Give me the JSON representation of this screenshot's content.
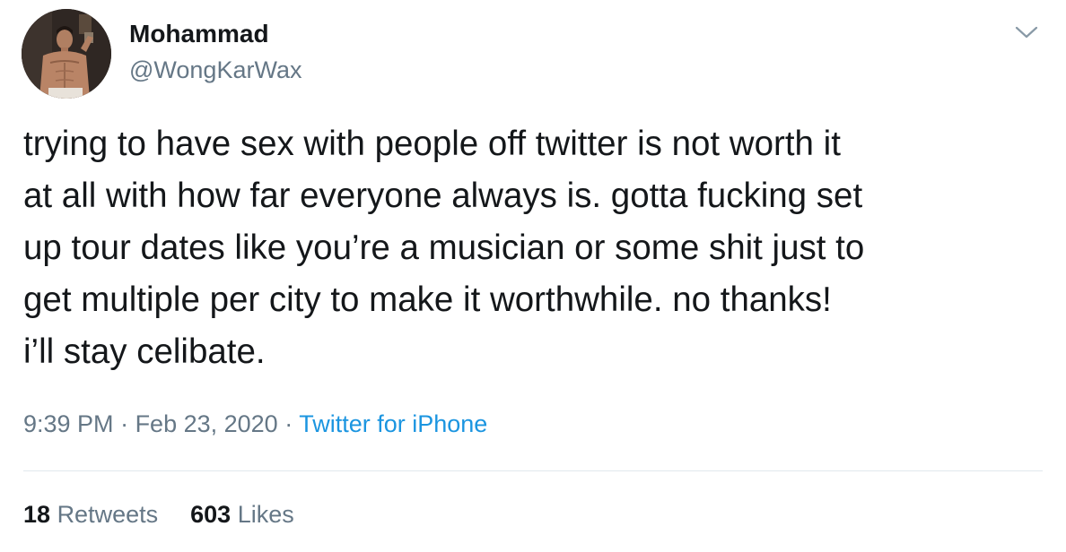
{
  "author": {
    "display_name": "Mohammad",
    "handle": "@WongKarWax",
    "avatar_icon": "profile-photo"
  },
  "menu": {
    "icon": "chevron-down-icon"
  },
  "tweet": {
    "lines": [
      "trying to have sex with people off twitter is not worth it",
      "at all with how far everyone always is. gotta fucking set",
      "up tour dates like you’re a musician or some shit just to",
      "get multiple per city to make it worthwhile. no thanks!",
      "i’ll stay celibate."
    ]
  },
  "meta": {
    "time": "9:39 PM",
    "separator": " · ",
    "date": "Feb 23, 2020",
    "source": "Twitter for iPhone"
  },
  "stats": {
    "retweets_count": "18",
    "retweets_label": "Retweets",
    "likes_count": "603",
    "likes_label": "Likes"
  },
  "colors": {
    "text": "#14171a",
    "secondary": "#657786",
    "link": "#1b95e0",
    "divider": "#e1e8ed"
  }
}
